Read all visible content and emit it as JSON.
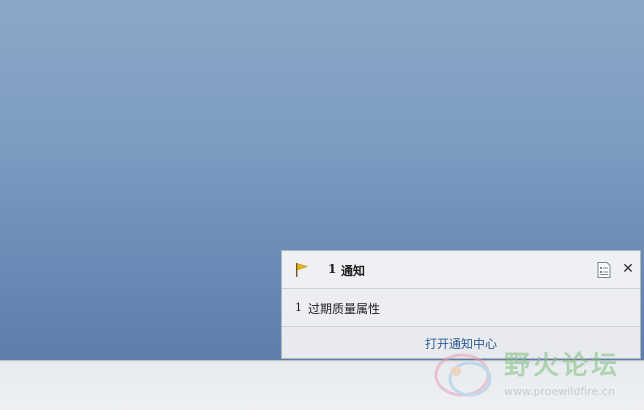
{
  "notification_panel": {
    "count": "1",
    "title": "通知",
    "items": [
      {
        "number": "1",
        "text": "过期质量属性"
      }
    ],
    "footer_link": "打开通知中心",
    "icons": {
      "flag": "flag-icon",
      "list": "list-icon",
      "close": "close-icon"
    },
    "colors": {
      "flag": "#e8b41c",
      "link": "#2b5d93"
    }
  },
  "watermark": {
    "title": "野火论坛",
    "url": "www.proewildfire.cn"
  }
}
